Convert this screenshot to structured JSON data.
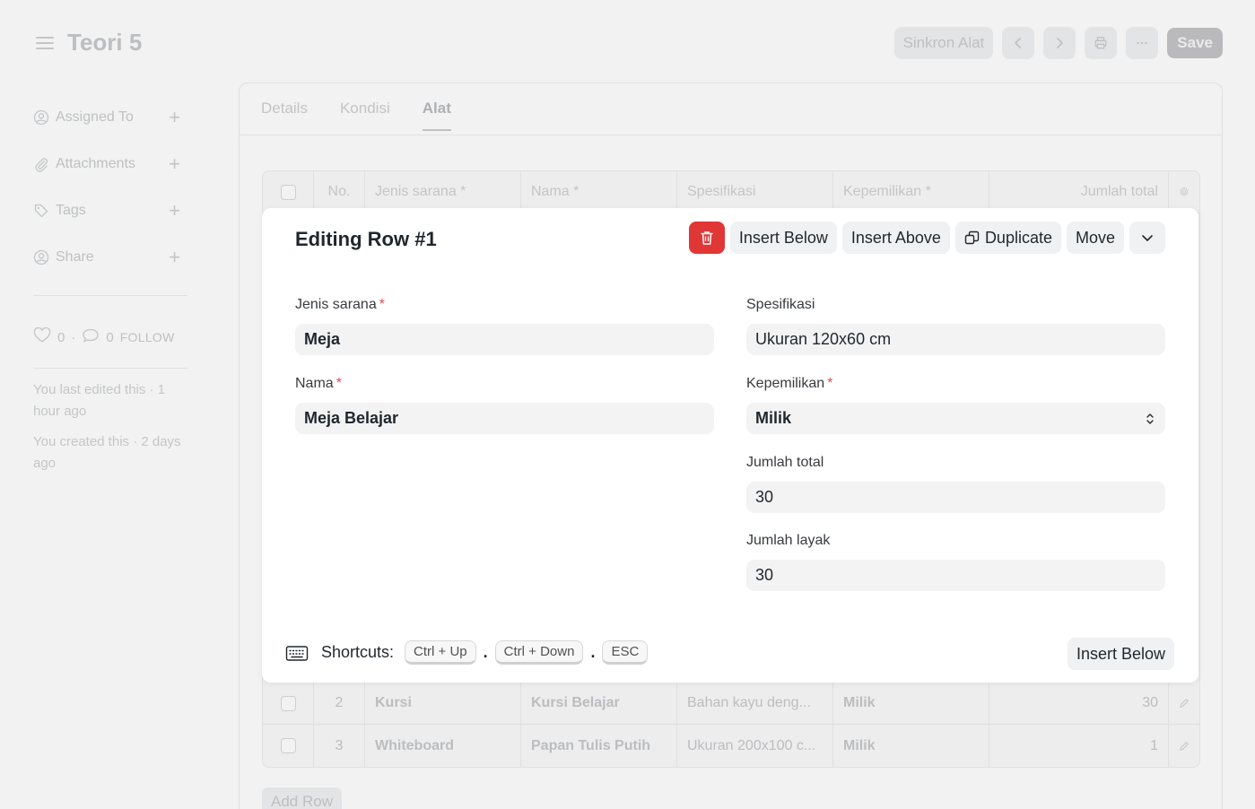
{
  "header": {
    "title": "Teori 5",
    "sync_label": "Sinkron Alat",
    "save_label": "Save"
  },
  "sidebar": {
    "items": [
      {
        "label": "Assigned To",
        "icon": "user-circle-icon"
      },
      {
        "label": "Attachments",
        "icon": "paperclip-icon"
      },
      {
        "label": "Tags",
        "icon": "tag-icon"
      },
      {
        "label": "Share",
        "icon": "share-user-icon"
      }
    ],
    "likes": "0",
    "comments": "0",
    "follow": "FOLLOW",
    "last_edited": "You last edited this · 1 hour ago",
    "created": "You created this · 2 days ago"
  },
  "tabs": [
    {
      "label": "Details"
    },
    {
      "label": "Kondisi"
    },
    {
      "label": "Alat",
      "active": true
    }
  ],
  "grid": {
    "headers": {
      "no": "No.",
      "jenis": "Jenis sarana *",
      "nama": "Nama *",
      "spek": "Spesifikasi",
      "kep": "Kepemilikan *",
      "jml": "Jumlah total"
    },
    "rows": [
      {
        "no": "2",
        "jenis": "Kursi",
        "nama": "Kursi Belajar",
        "spek": "Bahan kayu deng...",
        "kep": "Milik",
        "jml": "30"
      },
      {
        "no": "3",
        "jenis": "Whiteboard",
        "nama": "Papan Tulis Putih",
        "spek": "Ukuran 200x100 c...",
        "kep": "Milik",
        "jml": "1"
      }
    ],
    "add_row": "Add Row"
  },
  "editor": {
    "title": "Editing Row #1",
    "actions": {
      "insert_below": "Insert Below",
      "insert_above": "Insert Above",
      "duplicate": "Duplicate",
      "move": "Move"
    },
    "fields": {
      "jenis_label": "Jenis sarana",
      "jenis_value": "Meja",
      "nama_label": "Nama",
      "nama_value": "Meja Belajar",
      "spek_label": "Spesifikasi",
      "spek_value": "Ukuran 120x60 cm",
      "kep_label": "Kepemilikan",
      "kep_value": "Milik",
      "total_label": "Jumlah total",
      "total_value": "30",
      "layak_label": "Jumlah layak",
      "layak_value": "30"
    },
    "required_mark": "*",
    "shortcuts_label": "Shortcuts:",
    "shortcuts": [
      "Ctrl + Up",
      "Ctrl + Down",
      "ESC"
    ],
    "separator": ".",
    "footer_insert_below": "Insert Below"
  },
  "colors": {
    "danger": "#e03636",
    "required": "#e24c4c"
  }
}
